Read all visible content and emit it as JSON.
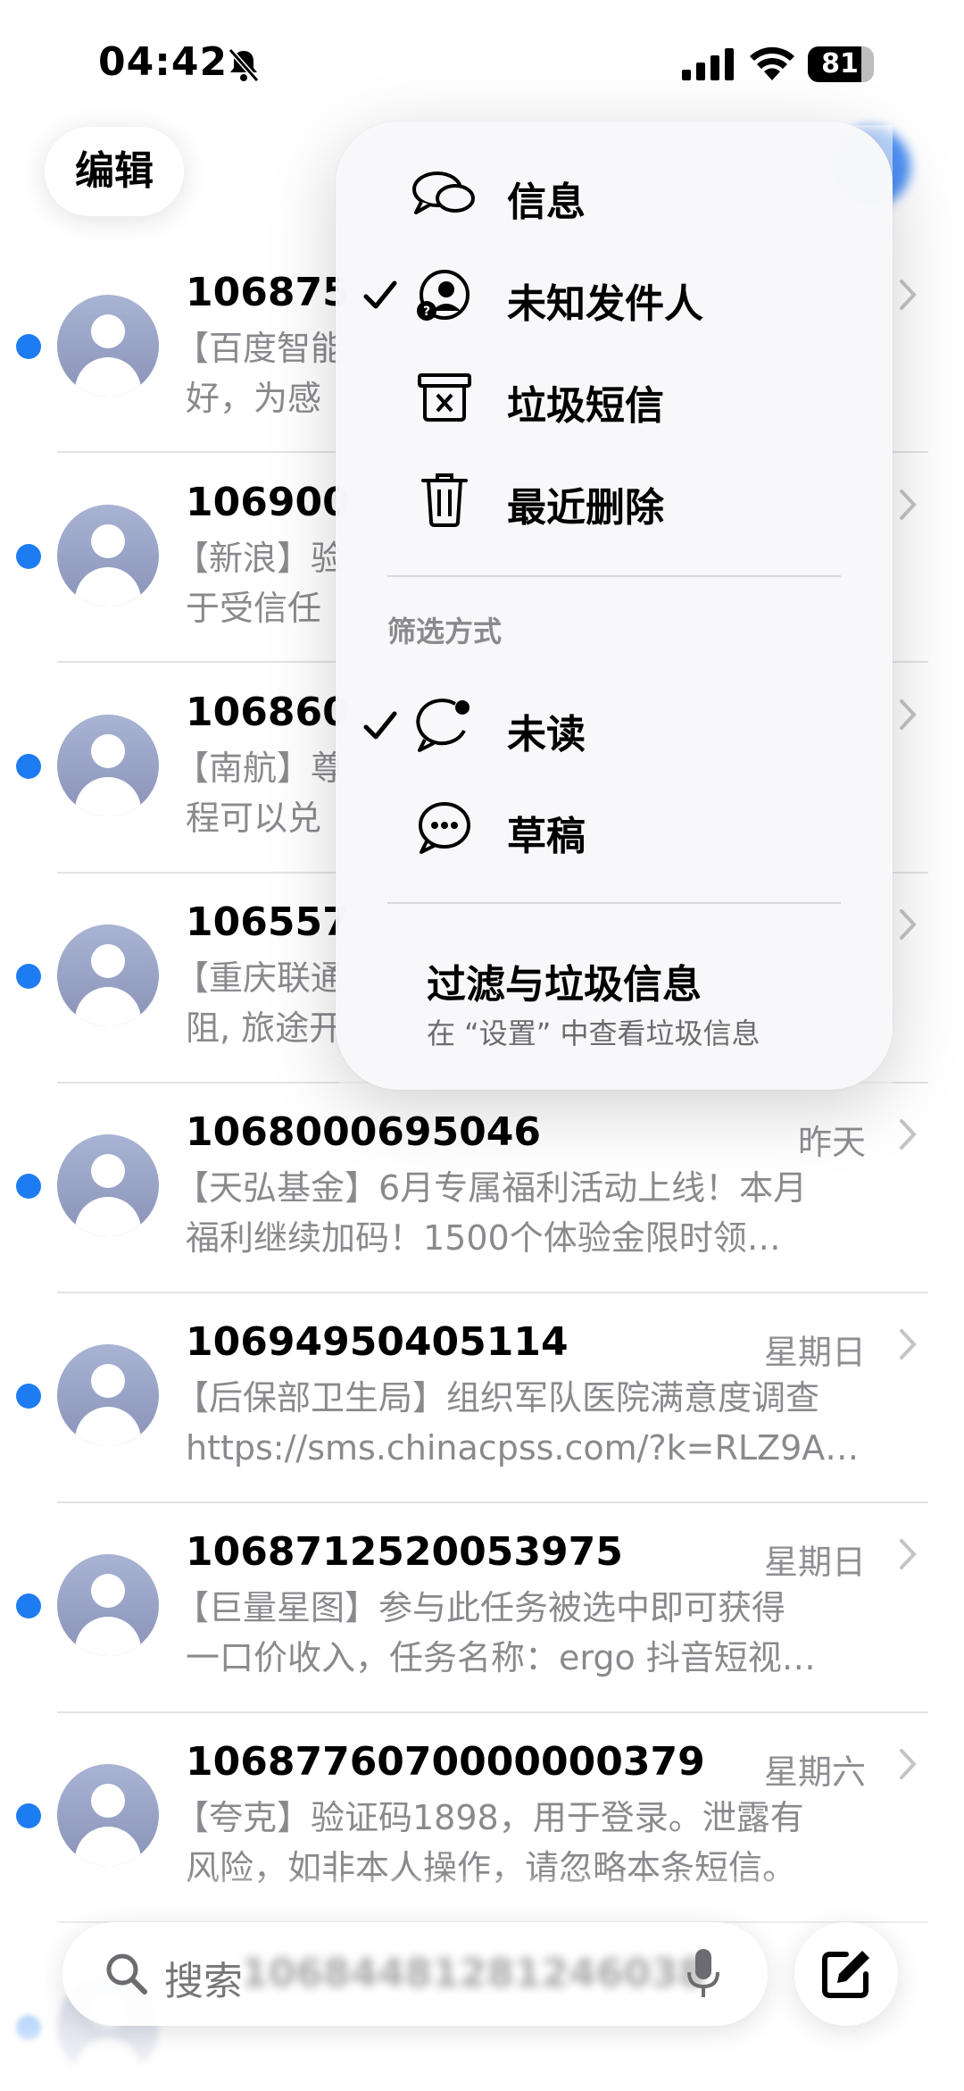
{
  "status_bar": {
    "time": "04:42",
    "battery": "81"
  },
  "header": {
    "edit_label": "编辑"
  },
  "messages": [
    {
      "sender": "106875",
      "time": "",
      "line1": "【百度智能",
      "line2": "好，为感"
    },
    {
      "sender": "106900",
      "time": "",
      "line1": "【新浪】验",
      "line2": "于受信任"
    },
    {
      "sender": "106860",
      "time": "",
      "line1": "【南航】尊",
      "line2": "程可以兑"
    },
    {
      "sender": "106557",
      "time": "",
      "line1": "【重庆联通",
      "line2": "阻, 旅途开"
    },
    {
      "sender": "1068000695046",
      "time": "昨天",
      "line1": "【天弘基金】6月专属福利活动上线！本月",
      "line2": "福利继续加码！1500个体验金限时领…"
    },
    {
      "sender": "10694950405114",
      "time": "星期日",
      "line1": "【后保部卫生局】组织军队医院满意度调查",
      "line2": "https://sms.chinacpss.com/?k=RLZ9A…"
    },
    {
      "sender": "1068712520053975",
      "time": "星期日",
      "line1": "【巨量星图】参与此任务被选中即可获得",
      "line2": "一口价收入，任务名称：ergo 抖音短视…"
    },
    {
      "sender": "1068776070000000379",
      "time": "星期六",
      "line1": "【夸克】验证码1898，用于登录。泄露有",
      "line2": "风险，如非本人操作，请忽略本条短信。"
    }
  ],
  "menu": {
    "items": [
      {
        "label": "信息",
        "checked": false,
        "icon": "message-bubbles-icon"
      },
      {
        "label": "未知发件人",
        "checked": true,
        "icon": "unknown-sender-icon"
      },
      {
        "label": "垃圾短信",
        "checked": false,
        "icon": "junk-bin-icon"
      },
      {
        "label": "最近删除",
        "checked": false,
        "icon": "trash-icon"
      }
    ],
    "section_label": "筛选方式",
    "filters": [
      {
        "label": "未读",
        "checked": true,
        "icon": "unread-bubble-icon"
      },
      {
        "label": "草稿",
        "checked": false,
        "icon": "draft-bubble-icon"
      }
    ],
    "footer_title": "过滤与垃圾信息",
    "footer_subtitle": "在 “设置” 中查看垃圾信息"
  },
  "search": {
    "placeholder": "搜索",
    "blurred_behind": "10684481281246038"
  },
  "colors": {
    "unread": "#1d7cf2",
    "accent": "#3b86f5"
  }
}
